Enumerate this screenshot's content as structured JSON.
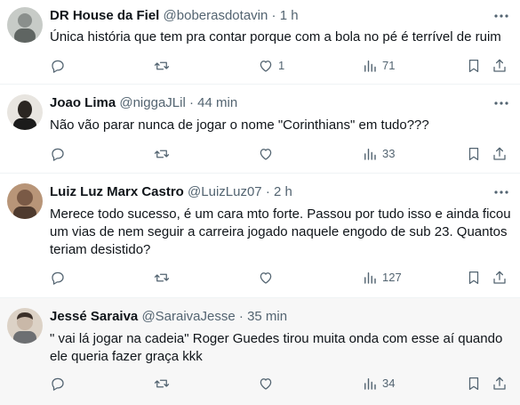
{
  "tweets": [
    {
      "name": "DR House da Fiel",
      "handle": "@boberasdotavin",
      "dot": "·",
      "time": "1 h",
      "lines": [
        "Única história que tem pra contar porque com a bola no pé é terrível de ruim"
      ],
      "replies": "",
      "reposts": "",
      "likes": "1",
      "views": "71",
      "avatar_color": "#8a8f8c"
    },
    {
      "name": "Joao Lima",
      "handle": "@niggaJLil",
      "dot": "·",
      "time": "44 min",
      "lines": [
        "Não vão parar nunca de jogar o nome \"Corinthians\" em tudo???"
      ],
      "replies": "",
      "reposts": "",
      "likes": "",
      "views": "33",
      "avatar_color": "#2b2622"
    },
    {
      "name": "Luiz Luz Marx Castro",
      "handle": "@LuizLuz07",
      "dot": "·",
      "time": "2 h",
      "lines": [
        "Merece todo sucesso, é um cara mto forte. Passou por tudo isso e ainda ficou",
        "um vias de nem seguir a carreira jogado naquele engodo de sub 23. Quantos",
        "teriam desistido?"
      ],
      "replies": "",
      "reposts": "",
      "likes": "",
      "views": "127",
      "avatar_color": "#7a5a46"
    },
    {
      "name": "Jessé Saraiva",
      "handle": "@SaraivaJesse",
      "dot": "·",
      "time": "35 min",
      "lines": [
        "\" vai lá jogar na cadeia\" Roger Guedes tirou muita onda com esse aí quando",
        "ele queria fazer graça kkk"
      ],
      "replies": "",
      "reposts": "",
      "likes": "",
      "views": "34",
      "avatar_color": "#c9b8a8"
    }
  ],
  "colors": {
    "icon": "#536471",
    "text": "#0f1419",
    "secondary": "#536471",
    "divider": "#eff3f4",
    "hover_bg": "#f7f7f7"
  },
  "icons": [
    "more-icon",
    "reply-icon",
    "repost-icon",
    "like-icon",
    "views-icon",
    "bookmark-icon",
    "share-icon"
  ]
}
